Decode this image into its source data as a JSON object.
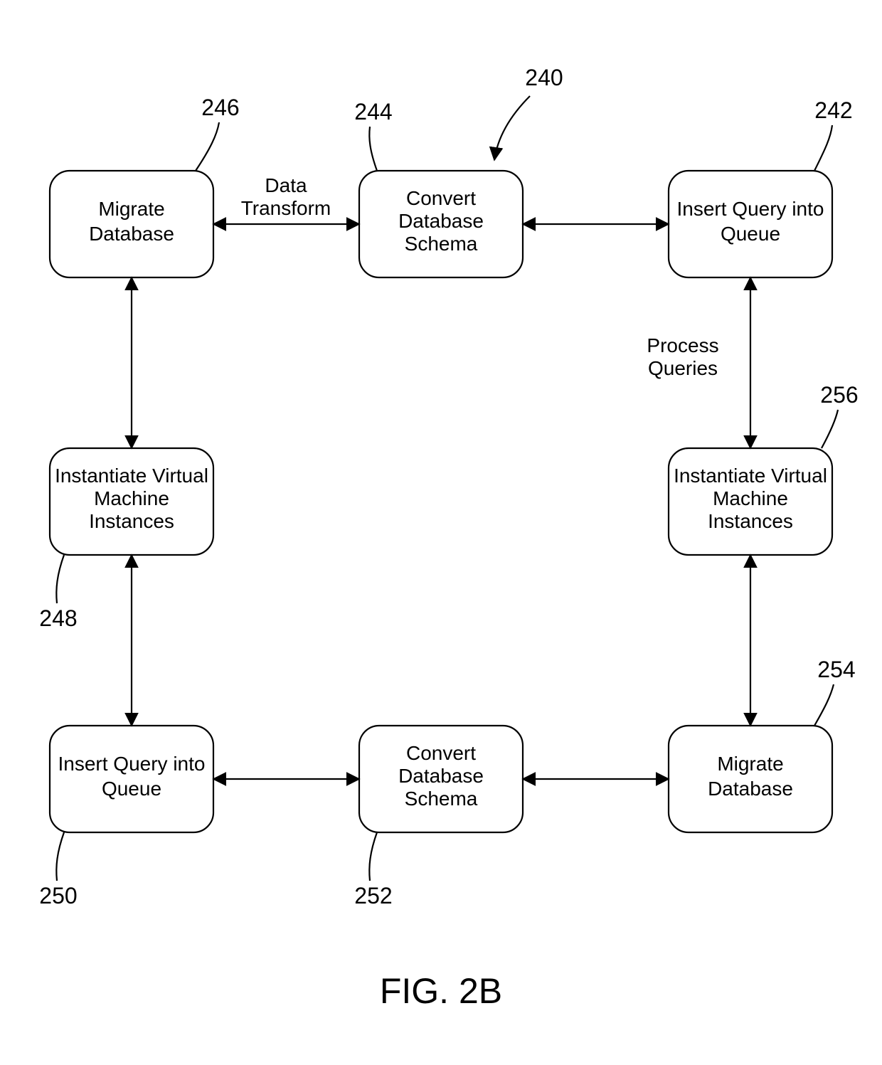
{
  "figure": {
    "caption": "FIG. 2B",
    "ref_global": "240"
  },
  "nodes": {
    "n242": {
      "ref": "242",
      "line1": "Insert Query into",
      "line2": "Queue"
    },
    "n244": {
      "ref": "244",
      "line1": "Convert",
      "line2": "Database",
      "line3": "Schema"
    },
    "n246": {
      "ref": "246",
      "line1": "Migrate",
      "line2": "Database"
    },
    "n248": {
      "ref": "248",
      "line1": "Instantiate Virtual",
      "line2": "Machine",
      "line3": "Instances"
    },
    "n250": {
      "ref": "250",
      "line1": "Insert Query into",
      "line2": "Queue"
    },
    "n252": {
      "ref": "252",
      "line1": "Convert",
      "line2": "Database",
      "line3": "Schema"
    },
    "n254": {
      "ref": "254",
      "line1": "Migrate",
      "line2": "Database"
    },
    "n256": {
      "ref": "256",
      "line1": "Instantiate Virtual",
      "line2": "Machine",
      "line3": "Instances"
    }
  },
  "edges": {
    "e_data_transform": {
      "line1": "Data",
      "line2": "Transform"
    },
    "e_process_queries": {
      "line1": "Process",
      "line2": "Queries"
    }
  }
}
